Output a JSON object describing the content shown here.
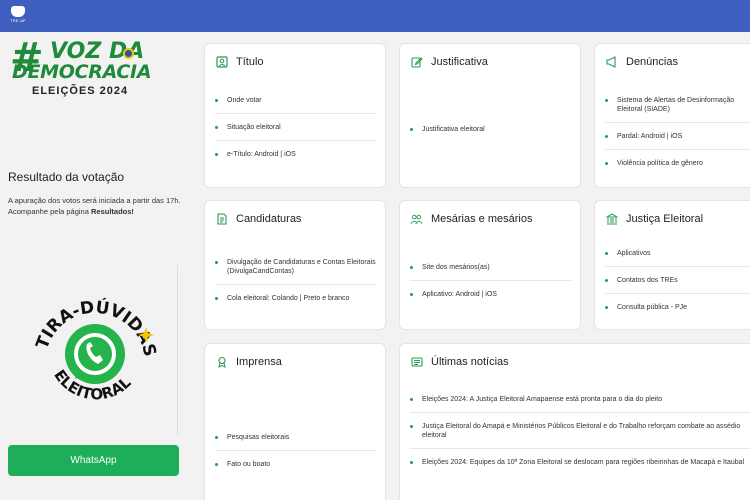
{
  "topbar": {
    "logo_text": "TRE-AP"
  },
  "brand": {
    "hash": "#",
    "line1": "VOZ DA",
    "line2": "DEMOCRACIA",
    "line3": "ELEIÇÕES 2024"
  },
  "sidebar": {
    "result_title": "Resultado da votação",
    "result_text": "A apuração dos votos será iniciada a partir das 17h. Acompanhe pela página",
    "result_link": "Resultados!",
    "tira": {
      "line1": "TIRA-DÚVIDAS",
      "line2": "ELEITORAL"
    },
    "whatsapp_button": "WhatsApp"
  },
  "cards": {
    "titulo": {
      "title": "Título",
      "items": [
        "Onde votar",
        "Situação eleitoral",
        "e-Título: Android | iOS"
      ]
    },
    "justificativa": {
      "title": "Justificativa",
      "items": [
        "Justificativa eleitoral"
      ]
    },
    "denuncias": {
      "title": "Denúncias",
      "items": [
        "Sistema de Alertas de Desinformação Eleitoral (SIADE)",
        "Pardal: Android | iOS",
        "Violência política de gênero"
      ]
    },
    "candidaturas": {
      "title": "Candidaturas",
      "items": [
        "Divulgação de Candidaturas e Contas Eleitorais (DivulgaCandContas)",
        "Cola eleitoral: Colando | Preto e branco"
      ]
    },
    "mesarios": {
      "title": "Mesárias e mesários",
      "items": [
        "Site dos mesários(as)",
        "Aplicativo: Android | iOS"
      ]
    },
    "justica": {
      "title": "Justiça Eleitoral",
      "items": [
        "Aplicativos",
        "Contatos dos TREs",
        "Consulta pública - PJe"
      ]
    },
    "imprensa": {
      "title": "Imprensa",
      "items": [
        "Pesquisas eleitorais",
        "Fato ou boato"
      ]
    },
    "noticias": {
      "title": "Últimas notícias",
      "items": [
        "Eleições 2024: A Justiça Eleitoral Amapaense está pronta para o dia do pleito",
        "Justiça Eleitoral do Amapá e Ministérios Públicos Eleitoral e do Trabalho reforçam combate ao assédio eleitoral",
        "Eleições 2024: Equipes da 10ª Zona Eleitoral se deslocam para regiões ribeirinhas de Macapá e Itaubal"
      ]
    }
  },
  "colors": {
    "topbar": "#3f5fbf",
    "accent": "#2a9a55",
    "whatsapp": "#1eae5a"
  }
}
